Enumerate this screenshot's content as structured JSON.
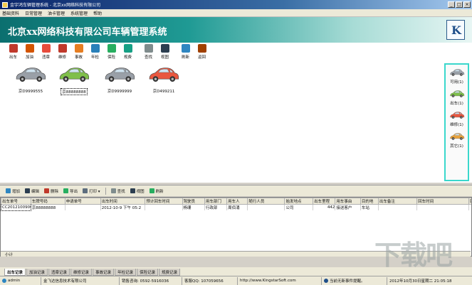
{
  "window": {
    "title": "金宇鸿车辆管理系统 - 北京xx网络科技有限公司",
    "buttons": [
      "_",
      "□",
      "×"
    ]
  },
  "menu": [
    "基础资料",
    "日常管理",
    "油卡管理",
    "系统管理",
    "帮助"
  ],
  "banner": {
    "title": "北京xx网络科技有限公司车辆管理系统",
    "logo_letter": "K"
  },
  "toolbar": [
    {
      "label": "出车",
      "icon": "car-out-icon",
      "color": "#c0392b"
    },
    {
      "label": "加油",
      "icon": "fuel-icon",
      "color": "#d35400"
    },
    {
      "label": "违章",
      "icon": "violation-icon",
      "color": "#e74c3c"
    },
    {
      "label": "维修",
      "icon": "repair-icon",
      "color": "#c0392b"
    },
    {
      "label": "事故",
      "icon": "accident-icon",
      "color": "#e67e22"
    },
    {
      "label": "年检",
      "icon": "inspection-icon",
      "color": "#2980b9"
    },
    {
      "label": "保险",
      "icon": "insurance-icon",
      "color": "#27ae60"
    },
    {
      "label": "规费",
      "icon": "fee-icon",
      "color": "#16a085"
    },
    {
      "label": "查找",
      "icon": "find-icon",
      "color": "#7f8c8d"
    },
    {
      "label": "视图",
      "icon": "view-icon",
      "color": "#2c3e50"
    },
    {
      "label": "刷新",
      "icon": "refresh-icon",
      "color": "#2e86c1"
    },
    {
      "label": "返回",
      "icon": "home-icon",
      "color": "#a04000"
    }
  ],
  "cars": [
    {
      "plate": "京D9999555",
      "color": "#9aa0a8",
      "selected": false
    },
    {
      "plate": "京88888888",
      "color": "#7fbf4a",
      "selected": true
    },
    {
      "plate": "京D9999999",
      "color": "#9aa0a8",
      "selected": false
    },
    {
      "plate": "京D499211",
      "color": "#e9573f",
      "selected": false
    }
  ],
  "status_panel": [
    {
      "label": "可用(1)",
      "color": "#9aa0a8"
    },
    {
      "label": "出车(1)",
      "color": "#7fbf4a"
    },
    {
      "label": "维修(1)",
      "color": "#e9573f"
    },
    {
      "label": "其它(1)",
      "color": "#e9a23b"
    }
  ],
  "lower_toolbar": [
    {
      "label": "增加",
      "icon": "add-icon",
      "color": "#2e86c1"
    },
    {
      "label": "编辑",
      "icon": "edit-icon",
      "color": "#2c3e50"
    },
    {
      "label": "删除",
      "icon": "delete-icon",
      "color": "#c0392b"
    },
    {
      "label": "导出",
      "icon": "export-icon",
      "color": "#27ae60"
    },
    {
      "label": "打印 ▾",
      "icon": "print-icon",
      "color": "#5d6d7e"
    },
    {
      "label": "查找",
      "icon": "find-icon",
      "color": "#7f8c8d"
    },
    {
      "label": "视图",
      "icon": "view-icon",
      "color": "#2c3e50"
    },
    {
      "label": "刷新",
      "icon": "refresh-icon",
      "color": "#27ae60"
    }
  ],
  "grid": {
    "columns": [
      "出车单号",
      "车牌号码",
      "申请单号",
      "出车时间",
      "预计回车时间",
      "驾驶员",
      "用车部门",
      "用车人",
      "随行人员",
      "始发地点",
      "出车里程",
      "用车事由",
      "目的地",
      "出车备注",
      "回车时间",
      "回车里程"
    ],
    "widths": [
      40,
      46,
      48,
      60,
      50,
      30,
      30,
      28,
      50,
      38,
      30,
      34,
      24,
      52,
      70,
      40
    ],
    "rows": [
      [
        "CC20121009002",
        "京88888888",
        "",
        "2012-10-9 下午 05:2",
        "",
        "杨珊",
        "行政部",
        "周佰涌",
        "",
        "公司",
        "442",
        "接送客户",
        "车站",
        "",
        "",
        ""
      ]
    ],
    "total_label": "小计"
  },
  "tabs": [
    {
      "label": "出车记录",
      "active": true
    },
    {
      "label": "加油记录",
      "active": false
    },
    {
      "label": "违章记录",
      "active": false
    },
    {
      "label": "维修记录",
      "active": false
    },
    {
      "label": "事故记录",
      "active": false
    },
    {
      "label": "年检记录",
      "active": false
    },
    {
      "label": "保险记录",
      "active": false
    },
    {
      "label": "规费记录",
      "active": false
    }
  ],
  "statusbar": {
    "user": "admin",
    "company": "金飞达信息技术有限公司",
    "sales": "销售咨询: 0592-5916036",
    "qq": "客服QQ: 107059656",
    "website": "http://www.KingstarSoft.com",
    "event": "当前无新事件提醒。",
    "datetime": "2012年10月30日星期二 21:05:18"
  },
  "watermark": "下载吧"
}
